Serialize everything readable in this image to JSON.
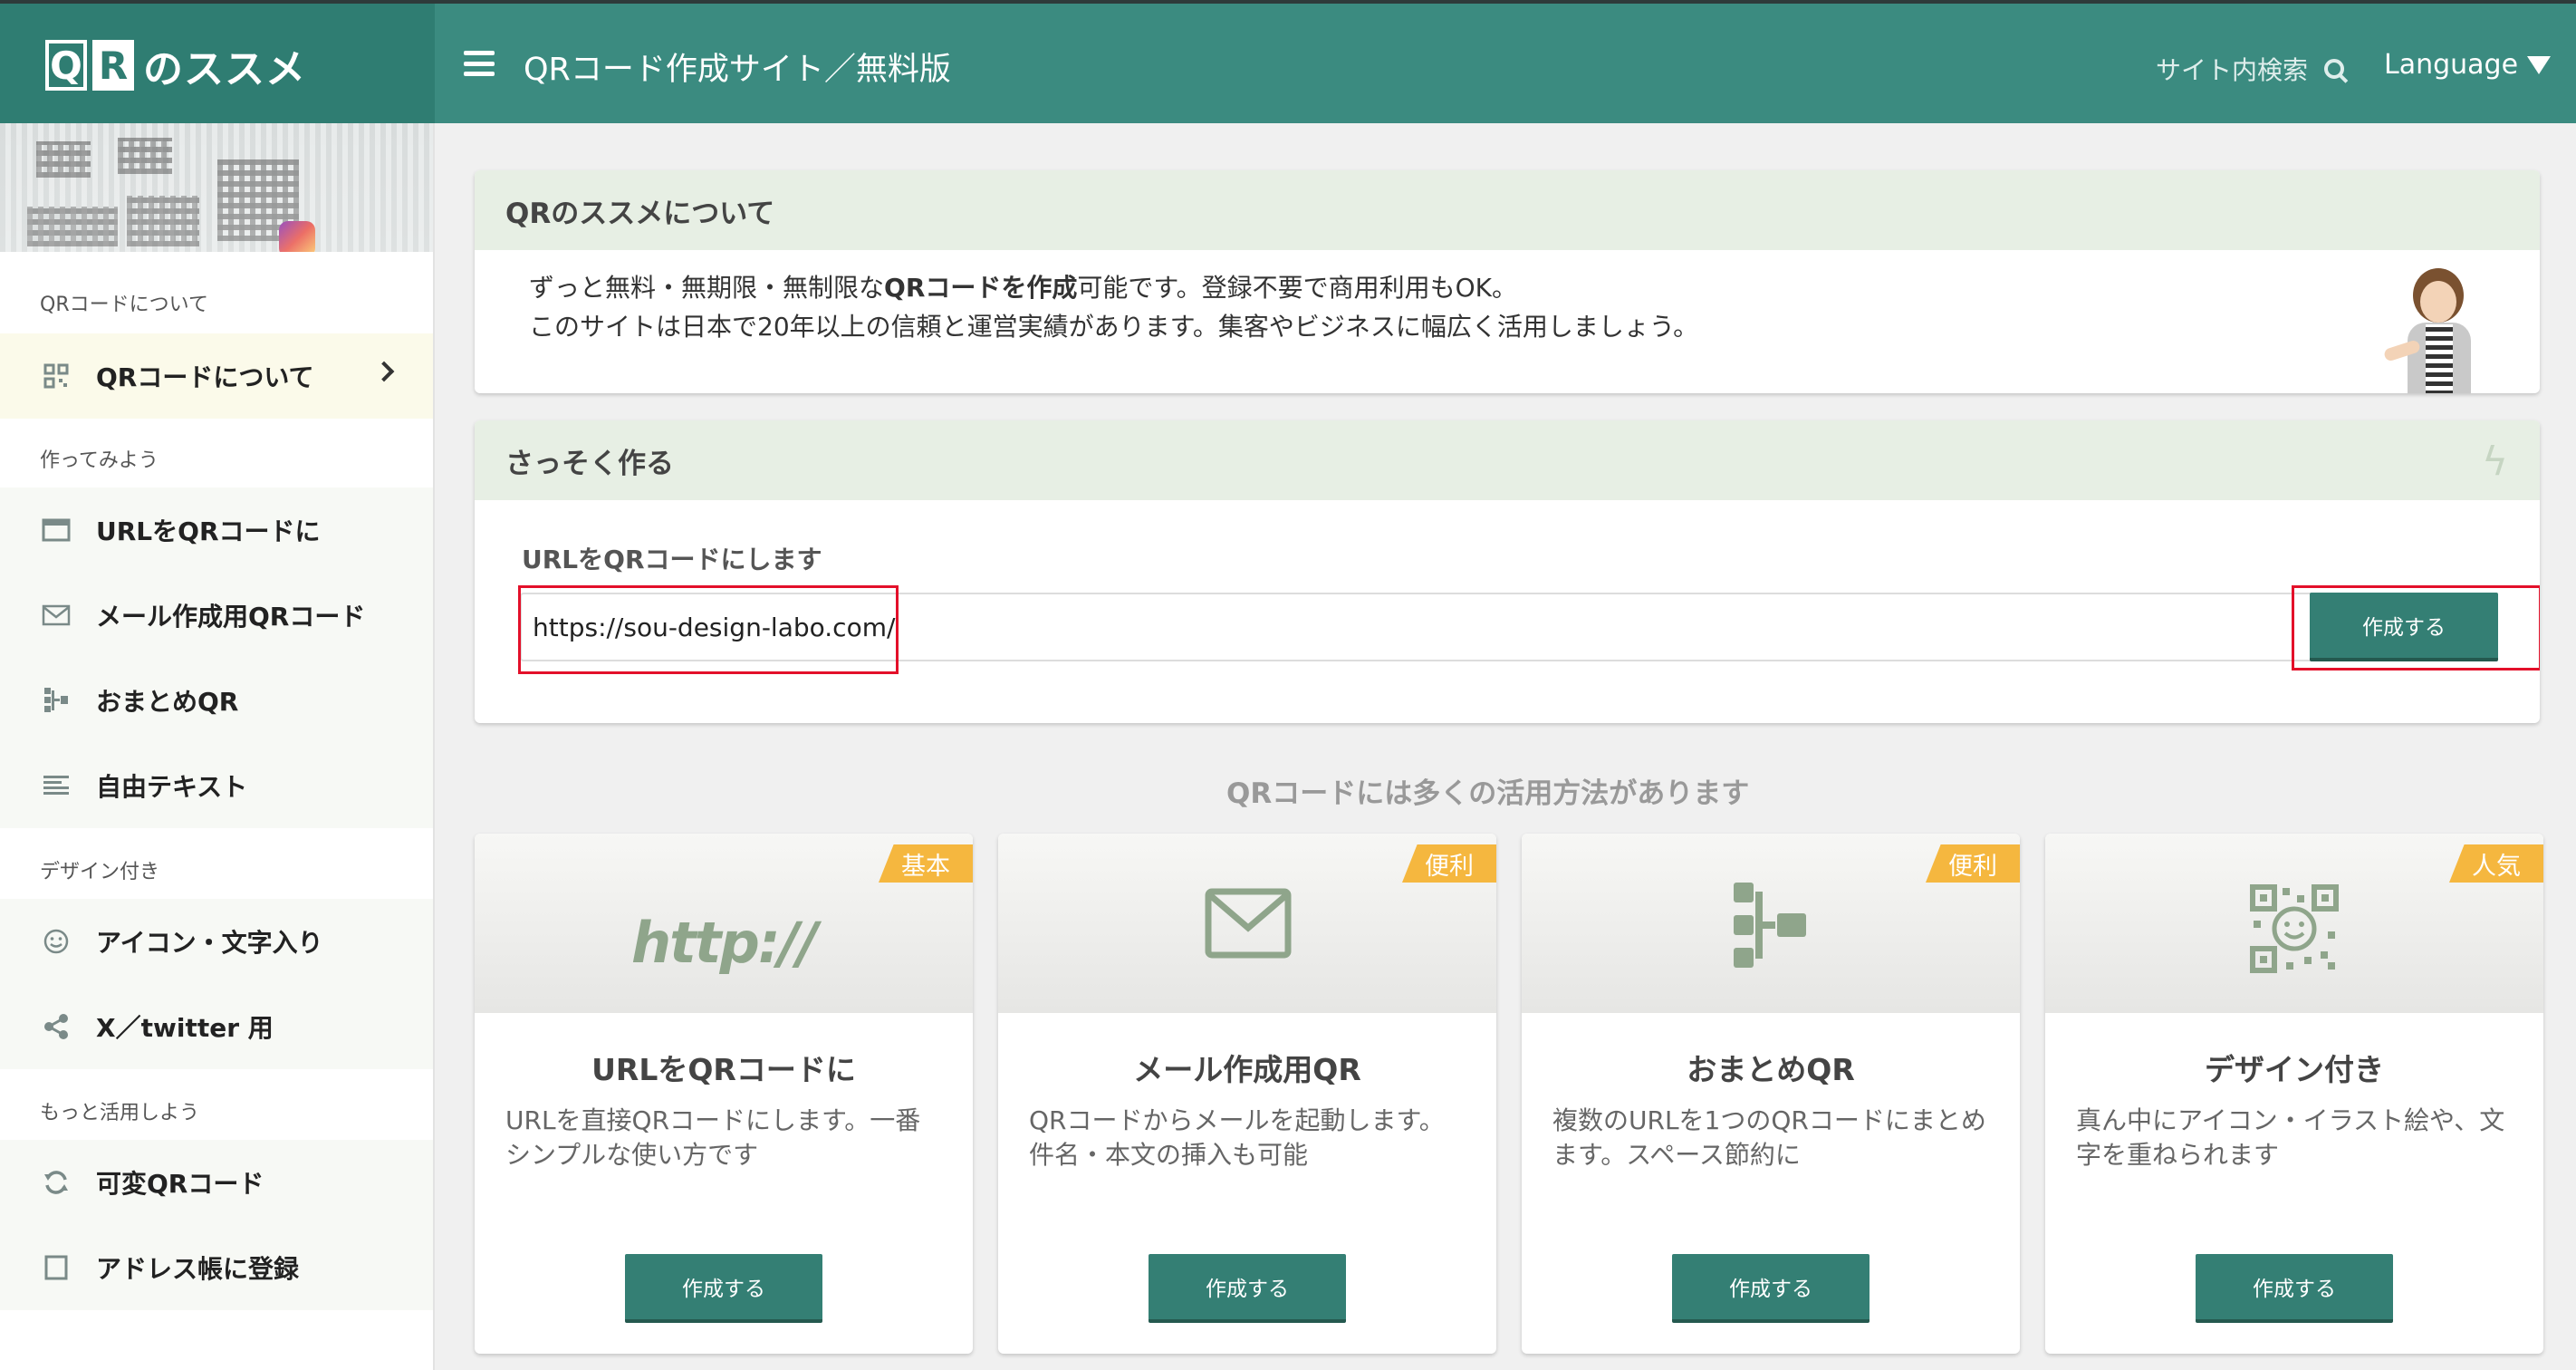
{
  "header": {
    "logo_q": "Q",
    "logo_r": "R",
    "logo_rest": "のススメ",
    "site_title": "QRコード作成サイト／無料版",
    "search_label": "サイト内検索",
    "language_label": "Language"
  },
  "sidebar": {
    "sections": [
      {
        "title": "QRコードについて",
        "items": [
          {
            "label": "QRコードについて",
            "icon": "qr-icon",
            "active": true
          }
        ]
      },
      {
        "title": "作ってみよう",
        "items": [
          {
            "label": "URLをQRコードに",
            "icon": "browser-window-icon"
          },
          {
            "label": "メール作成用QRコード",
            "icon": "mail-icon"
          },
          {
            "label": "おまとめQR",
            "icon": "tree-icon"
          },
          {
            "label": "自由テキスト",
            "icon": "text-lines-icon"
          }
        ]
      },
      {
        "title": "デザイン付き",
        "items": [
          {
            "label": "アイコン・文字入り",
            "icon": "smiley-icon"
          },
          {
            "label": "X／twitter 用",
            "icon": "share-icon"
          }
        ]
      },
      {
        "title": "もっと活用しよう",
        "items": [
          {
            "label": "可変QRコード",
            "icon": "refresh-icon"
          },
          {
            "label": "アドレス帳に登録",
            "icon": "address-book-icon"
          }
        ]
      }
    ]
  },
  "about": {
    "heading": "QRのススメについて",
    "line1_pre": "ずっと無料・無期限・無制限な",
    "line1_bold": "QRコードを作成",
    "line1_post": "可能です。登録不要で商用利用もOK。",
    "line2": "このサイトは日本で20年以上の信頼と運営実績があります。集客やビジネスに幅広く活用しましょう。"
  },
  "quick": {
    "heading": "さっそく作る",
    "label": "URLをQRコードにします",
    "url_value": "https://sou-design-labo.com/",
    "button": "作成する"
  },
  "features": {
    "title": "QRコードには多くの活用方法があります",
    "cards": [
      {
        "badge": "基本",
        "icon_text": "http://",
        "title": "URLをQRコードに",
        "desc": "URLを直接QRコードにします。一番シンプルな使い方です",
        "button": "作成する"
      },
      {
        "badge": "便利",
        "title": "メール作成用QR",
        "desc": "QRコードからメールを起動します。件名・本文の挿入も可能",
        "button": "作成する"
      },
      {
        "badge": "便利",
        "title": "おまとめQR",
        "desc": "複数のURLを1つのQRコードにまとめます。スペース節約に",
        "button": "作成する"
      },
      {
        "badge": "人気",
        "title": "デザイン付き",
        "desc": "真ん中にアイコン・イラスト絵や、文字を重ねられます",
        "button": "作成する"
      }
    ]
  },
  "colors": {
    "header_bg": "#3b8b80",
    "accent_button": "#347f74",
    "badge": "#f5b73f",
    "highlight_border": "#e3102a"
  }
}
